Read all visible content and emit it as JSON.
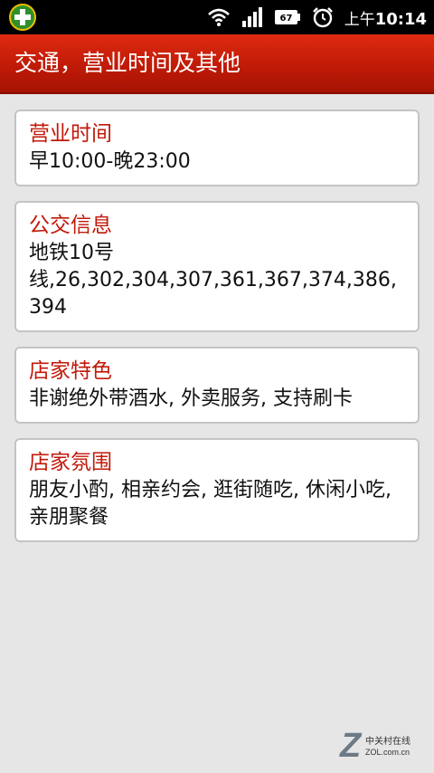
{
  "status_bar": {
    "app_icon": "plus-badge-icon",
    "wifi_icon": "wifi-icon",
    "signal_icon": "signal-bars-icon",
    "battery_level": "67",
    "alarm_icon": "alarm-clock-icon",
    "clock_prefix": "上午",
    "clock_time": "10:14"
  },
  "header": {
    "title": "交通，营业时间及其他"
  },
  "cards": [
    {
      "title": "营业时间",
      "body": "早10:00-晚23:00"
    },
    {
      "title": "公交信息",
      "body": "地铁10号\n线,26,302,304,307,361,367,374,386,394"
    },
    {
      "title": "店家特色",
      "body": "非谢绝外带酒水, 外卖服务, 支持刷卡"
    },
    {
      "title": "店家氛围",
      "body": "朋友小酌, 相亲约会, 逛街随吃, 休闲小吃, 亲朋聚餐"
    }
  ],
  "watermark": {
    "letter": "Z",
    "name_cn": "中关村在线",
    "domain": "ZOL.com.cn"
  },
  "colors": {
    "title_bar": "#c01b07",
    "card_title": "#c1190a",
    "background": "#e6e6e6"
  }
}
